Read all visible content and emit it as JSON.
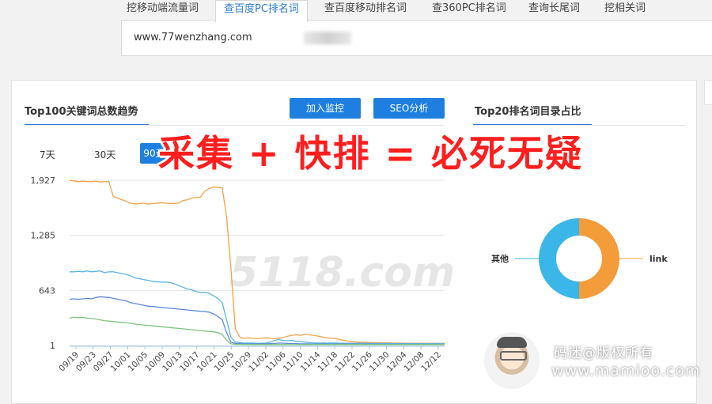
{
  "tabs": [
    {
      "label": "挖移动端流量词",
      "active": false
    },
    {
      "label": "查百度PC排名词",
      "active": true
    },
    {
      "label": "查百度移动排名词",
      "active": false
    },
    {
      "label": "查360PC排名词",
      "active": false
    },
    {
      "label": "查询长尾词",
      "active": false
    },
    {
      "label": "挖相关词",
      "active": false
    }
  ],
  "url_field": {
    "value": "www.77wenzhang.com"
  },
  "trend": {
    "title": "Top100关键词总数趋势",
    "add_monitor_button": "加入监控",
    "seo_button": "SEO分析",
    "ranges": [
      "7天",
      "30天",
      "90天"
    ],
    "active_range": "90天"
  },
  "distribution": {
    "title": "Top20排名词目录占比"
  },
  "overlay": {
    "caption": "采集 + 快排 = 必死无疑"
  },
  "watermarks": {
    "chart_watermark": "5118.com",
    "author": "码迷@版权所有",
    "author_url": "www.mamioo.com"
  },
  "colors": {
    "accent": "#1f7fe0",
    "series_orange": "#f6a14a",
    "series_blue": "#5bb4e6",
    "series_green": "#7dc67d",
    "donut_blue": "#3ab6e8",
    "donut_orange": "#f49b3a",
    "overlay_red": "#ff1e1e"
  },
  "chart_data": [
    {
      "type": "line",
      "title": "Top100关键词总数趋势",
      "y_ticks": [
        1,
        643,
        1285,
        1927
      ],
      "ylim": [
        1,
        1927
      ],
      "x_tick_labels": [
        "09/19",
        "09/23",
        "09/27",
        "10/01",
        "10/05",
        "10/09",
        "10/13",
        "10/17",
        "10/21",
        "10/25",
        "10/29",
        "11/02",
        "11/06",
        "11/10",
        "11/14",
        "11/18",
        "11/22",
        "11/26",
        "11/30",
        "12/04",
        "12/08",
        "12/12"
      ],
      "x_count": 87,
      "series": [
        {
          "color": "#f6a14a",
          "values": [
            1927,
            1920,
            1910,
            1915,
            1912,
            1910,
            1915,
            1908,
            1910,
            1912,
            1740,
            1720,
            1700,
            1680,
            1660,
            1650,
            1655,
            1660,
            1650,
            1655,
            1660,
            1665,
            1660,
            1655,
            1658,
            1660,
            1690,
            1700,
            1720,
            1725,
            1730,
            1800,
            1830,
            1850,
            1840,
            1840,
            1500,
            900,
            200,
            100,
            85,
            90,
            85,
            80,
            85,
            90,
            85,
            80,
            85,
            95,
            110,
            120,
            125,
            120,
            130,
            125,
            120,
            110,
            100,
            90,
            85,
            80,
            70,
            60,
            50,
            45,
            40,
            38,
            36,
            35,
            34,
            33,
            32,
            31,
            30,
            30,
            29,
            28,
            28,
            27,
            27,
            27,
            26,
            26,
            26,
            26,
            26
          ]
        },
        {
          "color": "#5bb4e6",
          "values": [
            860,
            860,
            865,
            860,
            870,
            860,
            865,
            870,
            850,
            860,
            860,
            850,
            840,
            830,
            810,
            790,
            780,
            770,
            760,
            750,
            745,
            740,
            740,
            735,
            720,
            700,
            680,
            660,
            650,
            630,
            620,
            620,
            610,
            580,
            550,
            500,
            300,
            100,
            40,
            35,
            30,
            30,
            30,
            28,
            28,
            30,
            40,
            60,
            70,
            60,
            55,
            60,
            50,
            45,
            40,
            35,
            30,
            30,
            30,
            30,
            30,
            30,
            28,
            28,
            28,
            28,
            28,
            26,
            26,
            26,
            26,
            25,
            25,
            25,
            24,
            24,
            24,
            23,
            23,
            23,
            22,
            22,
            22,
            22,
            22,
            22,
            22
          ]
        },
        {
          "color": "#5b8bd6",
          "values": [
            540,
            545,
            540,
            545,
            550,
            545,
            560,
            570,
            565,
            560,
            550,
            540,
            530,
            520,
            500,
            490,
            480,
            470,
            460,
            455,
            450,
            445,
            440,
            435,
            430,
            425,
            420,
            415,
            410,
            405,
            400,
            395,
            390,
            370,
            340,
            300,
            150,
            40,
            25,
            22,
            20,
            20,
            20,
            20,
            20,
            20,
            22,
            25,
            30,
            28,
            25,
            24,
            22,
            20,
            20,
            20,
            18,
            18,
            18,
            18,
            18,
            18,
            18,
            18,
            18,
            18,
            17,
            17,
            17,
            17,
            17,
            16,
            16,
            16,
            16,
            16,
            16,
            16,
            15,
            15,
            15,
            15,
            15,
            15,
            15,
            15,
            15
          ]
        },
        {
          "color": "#7dc67d",
          "values": [
            320,
            330,
            325,
            330,
            320,
            315,
            310,
            300,
            290,
            285,
            280,
            275,
            270,
            265,
            260,
            250,
            245,
            240,
            235,
            230,
            225,
            220,
            215,
            210,
            205,
            200,
            195,
            190,
            185,
            180,
            175,
            170,
            165,
            160,
            150,
            130,
            60,
            20,
            15,
            14,
            13,
            13,
            12,
            12,
            12,
            12,
            12,
            12,
            12,
            12,
            12,
            12,
            12,
            12,
            12,
            12,
            12,
            12,
            12,
            12,
            12,
            12,
            12,
            12,
            12,
            12,
            12,
            12,
            12,
            12,
            12,
            12,
            12,
            12,
            12,
            12,
            12,
            12,
            12,
            12,
            12,
            12,
            12,
            12,
            12,
            12,
            12
          ]
        }
      ]
    },
    {
      "type": "pie",
      "title": "Top20排名词目录占比",
      "slices": [
        {
          "label": "其他",
          "value": 50,
          "color": "#3ab6e8"
        },
        {
          "label": "link",
          "value": 50,
          "color": "#f49b3a"
        }
      ]
    }
  ]
}
